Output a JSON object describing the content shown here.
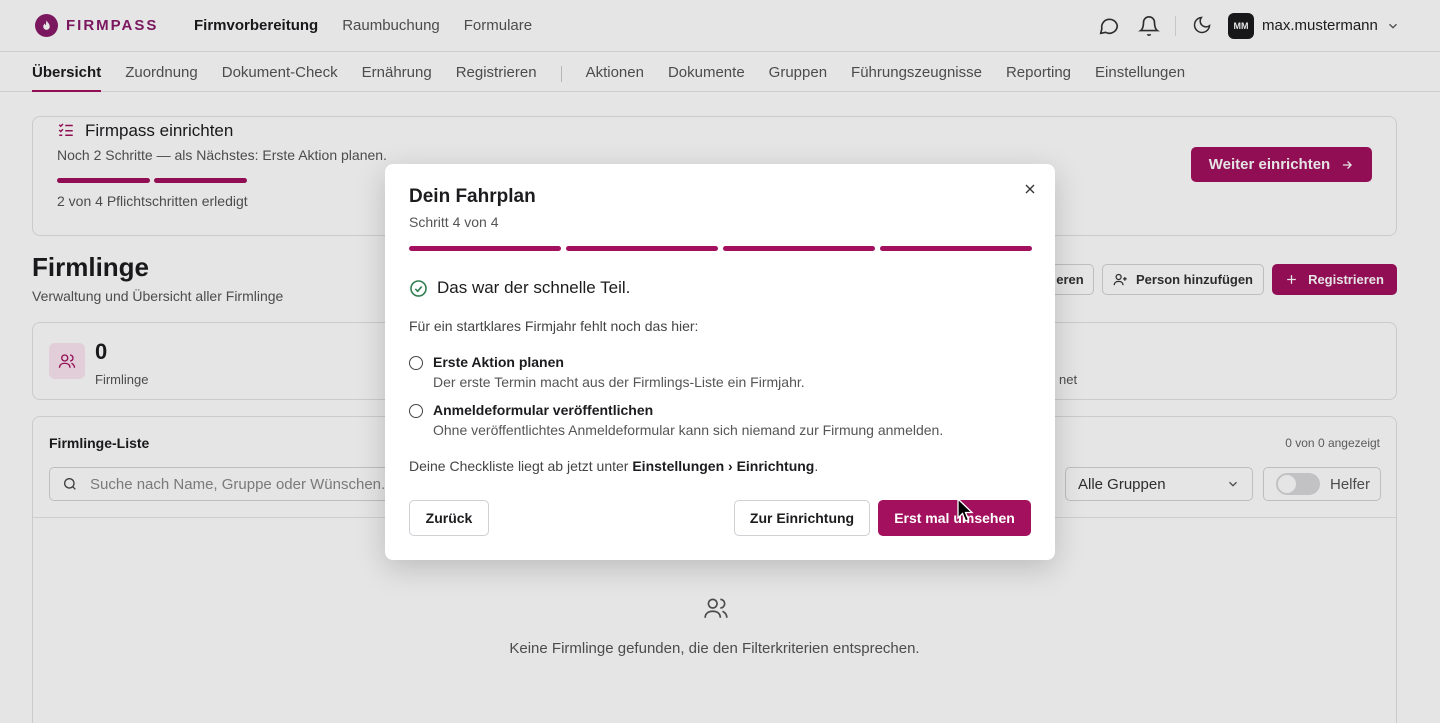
{
  "app": {
    "brand": "FIRMPASS",
    "user_initials": "MM",
    "username": "max.mustermann"
  },
  "main_nav": [
    {
      "label": "Firmvorbereitung",
      "active": true
    },
    {
      "label": "Raumbuchung",
      "active": false
    },
    {
      "label": "Formulare",
      "active": false
    }
  ],
  "sub_nav": [
    {
      "label": "Übersicht",
      "active": true
    },
    {
      "label": "Zuordnung"
    },
    {
      "label": "Dokument-Check"
    },
    {
      "label": "Ernährung"
    },
    {
      "label": "Registrieren"
    },
    {
      "label": "Aktionen"
    },
    {
      "label": "Dokumente"
    },
    {
      "label": "Gruppen"
    },
    {
      "label": "Führungszeugnisse"
    },
    {
      "label": "Reporting"
    },
    {
      "label": "Einstellungen"
    }
  ],
  "setup_banner": {
    "title": "Firmpass einrichten",
    "subtitle": "Noch 2 Schritte — als Nächstes: Erste Aktion planen.",
    "progress_label": "2 von 4 Pflichtschritten erledigt",
    "steps_done": 2,
    "steps_total": 4,
    "button": "Weiter einrichten"
  },
  "page": {
    "title": "Firmlinge",
    "subtitle": "Verwaltung und Übersicht aller Firmlinge",
    "btn_partial": "eren",
    "btn_add_person": "Person hinzufügen",
    "btn_register": "Registrieren"
  },
  "stats": {
    "count": "0",
    "label": "Firmlinge",
    "label2_partial": "net"
  },
  "list": {
    "title": "Firmlinge-Liste",
    "count": "0 von 0 angezeigt",
    "search_placeholder": "Suche nach Name, Gruppe oder Wünschen...",
    "group_select": "Alle Gruppen",
    "toggle_label": "Helfer",
    "empty": "Keine Firmlinge gefunden, die den Filterkriterien entsprechen."
  },
  "modal": {
    "title": "Dein Fahrplan",
    "step": "Schritt 4 von 4",
    "step_current": 4,
    "step_total": 4,
    "done": "Das war der schnelle Teil.",
    "intro": "Für ein startklares Firmjahr fehlt noch das hier:",
    "tasks": [
      {
        "title": "Erste Aktion planen",
        "desc": "Der erste Termin macht aus der Firmlings-Liste ein Firmjahr."
      },
      {
        "title": "Anmeldeformular veröffentlichen",
        "desc": "Ohne veröffentlichtes Anmeldeformular kann sich niemand zur Firmung anmelden."
      }
    ],
    "note_prefix": "Deine Checkliste liegt ab jetzt unter ",
    "note_path": "Einstellungen › Einrichtung",
    "note_suffix": ".",
    "btn_back": "Zurück",
    "btn_setup": "Zur Einrichtung",
    "btn_look": "Erst mal umsehen"
  },
  "colors": {
    "accent": "#a3105e",
    "success": "#2e7d4f"
  }
}
